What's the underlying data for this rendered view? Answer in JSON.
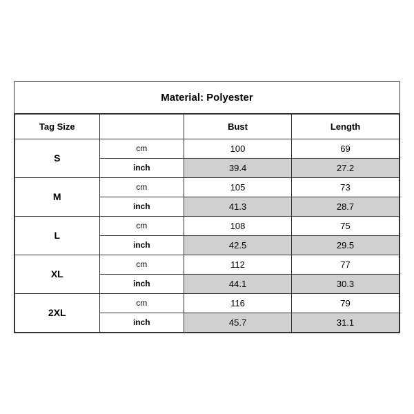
{
  "title": "Material: Polyester",
  "headers": {
    "tag_size": "Tag Size",
    "bust": "Bust",
    "length": "Length"
  },
  "rows": [
    {
      "size": "S",
      "cm": {
        "bust": "100",
        "length": "69"
      },
      "inch": {
        "bust": "39.4",
        "length": "27.2"
      }
    },
    {
      "size": "M",
      "cm": {
        "bust": "105",
        "length": "73"
      },
      "inch": {
        "bust": "41.3",
        "length": "28.7"
      }
    },
    {
      "size": "L",
      "cm": {
        "bust": "108",
        "length": "75"
      },
      "inch": {
        "bust": "42.5",
        "length": "29.5"
      }
    },
    {
      "size": "XL",
      "cm": {
        "bust": "112",
        "length": "77"
      },
      "inch": {
        "bust": "44.1",
        "length": "30.3"
      }
    },
    {
      "size": "2XL",
      "cm": {
        "bust": "116",
        "length": "79"
      },
      "inch": {
        "bust": "45.7",
        "length": "31.1"
      }
    }
  ]
}
